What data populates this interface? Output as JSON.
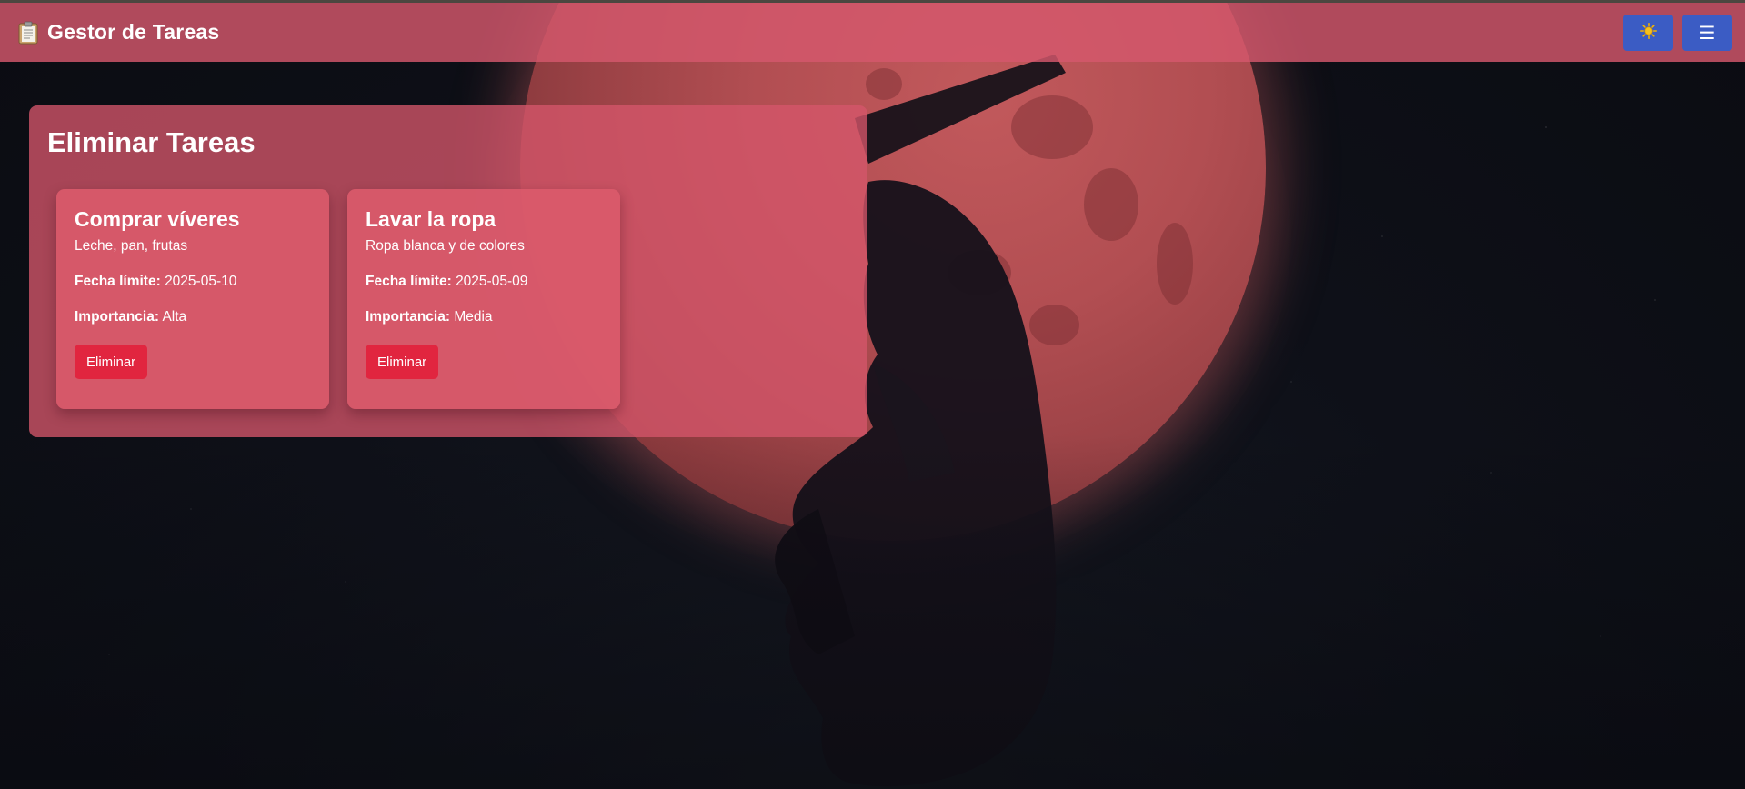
{
  "app": {
    "title": "Gestor de Tareas",
    "brand_icon": "clipboard-icon",
    "theme_toggle_icon": "sun-icon",
    "menu_icon": "hamburger-menu-icon",
    "menu_glyph": "☰"
  },
  "colors": {
    "header_bg": "#d4586c",
    "panel_bg": "#d5566a",
    "card_bg": "#da5a6c",
    "nav_button": "#3b5cc4",
    "delete_button": "#e1253f"
  },
  "panel": {
    "title": "Eliminar Tareas"
  },
  "labels": {
    "due_date": "Fecha límite:",
    "importance": "Importancia:",
    "delete": "Eliminar"
  },
  "tasks": [
    {
      "title": "Comprar víveres",
      "description": "Leche, pan, frutas",
      "due_date": "2025-05-10",
      "importance": "Alta"
    },
    {
      "title": "Lavar la ropa",
      "description": "Ropa blanca y de colores",
      "due_date": "2025-05-09",
      "importance": "Media"
    }
  ]
}
